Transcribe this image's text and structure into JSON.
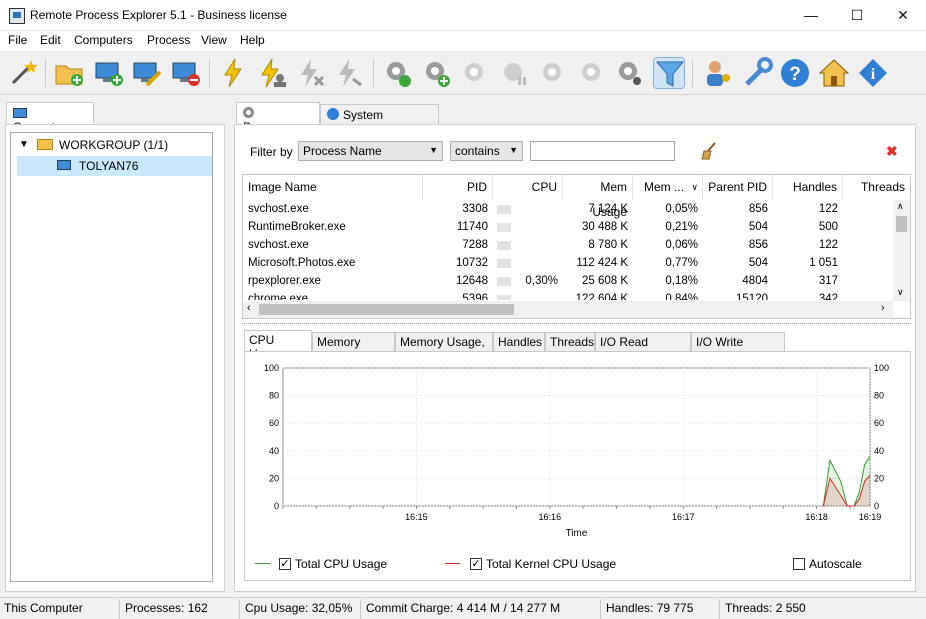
{
  "window": {
    "title": "Remote Process Explorer 5.1 - Business license",
    "minimize": "—",
    "maximize": "☐",
    "close": "✕"
  },
  "menu": [
    "File",
    "Edit",
    "Computers",
    "Process",
    "View",
    "Help"
  ],
  "left_panel": {
    "tab_label": "Computers",
    "group_label": "WORKGROUP (1/1)",
    "computer_label": "TOLYAN76"
  },
  "right_panel": {
    "tabs": [
      "Processes",
      "System Information"
    ],
    "filter": {
      "label": "Filter by",
      "field_value": "Process Name",
      "operator_value": "contains",
      "text_value": ""
    },
    "grid": {
      "columns": [
        "Image Name",
        "PID",
        "CPU",
        "Mem Usage",
        "Mem ...",
        "Parent PID",
        "Handles",
        "Threads"
      ],
      "rows": [
        {
          "name": "svchost.exe",
          "pid": "3308",
          "cpu": "",
          "mem": "7 124 K",
          "memp": "0,05%",
          "ppid": "856",
          "handles": "122"
        },
        {
          "name": "RuntimeBroker.exe",
          "pid": "11740",
          "cpu": "",
          "mem": "30 488 K",
          "memp": "0,21%",
          "ppid": "504",
          "handles": "500"
        },
        {
          "name": "svchost.exe",
          "pid": "7288",
          "cpu": "",
          "mem": "8 780 K",
          "memp": "0,06%",
          "ppid": "856",
          "handles": "122"
        },
        {
          "name": "Microsoft.Photos.exe",
          "pid": "10732",
          "cpu": "",
          "mem": "112 424 K",
          "memp": "0,77%",
          "ppid": "504",
          "handles": "1 051"
        },
        {
          "name": "rpexplorer.exe",
          "pid": "12648",
          "cpu": "0,30%",
          "mem": "25 608 K",
          "memp": "0,18%",
          "ppid": "4804",
          "handles": "317"
        },
        {
          "name": "chrome.exe",
          "pid": "5396",
          "cpu": "",
          "mem": "122 604 K",
          "memp": "0,84%",
          "ppid": "15120",
          "handles": "342"
        }
      ]
    },
    "chart_tabs": [
      "CPU Usage",
      "Memory Usage",
      "Memory Usage, %",
      "Handles",
      "Threads",
      "I/O Read Bytes/s",
      "I/O Write Bytes/s"
    ]
  },
  "chart_data": {
    "type": "area",
    "xlabel": "Time",
    "x_ticks": [
      "16:15",
      "16:16",
      "16:17",
      "16:18",
      "16:19"
    ],
    "y_ticks": [
      "100",
      "80",
      "60",
      "40",
      "20",
      "0"
    ],
    "y_ticks_right": [
      "100",
      "80",
      "60",
      "40",
      "20",
      "0"
    ],
    "ylim": [
      0,
      100
    ],
    "grid": true,
    "series": [
      {
        "name": "Total CPU Usage",
        "color": "#2ca02c",
        "x_min": [
          4.05,
          4.1,
          4.18,
          4.23,
          4.28,
          4.32,
          4.36,
          4.4
        ],
        "values": [
          0,
          33,
          18,
          0,
          0,
          10,
          30,
          36
        ]
      },
      {
        "name": "Total Kernel CPU Usage",
        "color": "#d62728",
        "x_min": [
          4.05,
          4.1,
          4.18,
          4.23,
          4.28,
          4.32,
          4.36,
          4.4
        ],
        "values": [
          0,
          20,
          8,
          0,
          0,
          5,
          18,
          22
        ]
      }
    ],
    "x_range_min": [
      0,
      4.4
    ],
    "x_tick_positions_min": [
      1,
      2,
      3,
      4,
      4.4
    ]
  },
  "legend": {
    "total_label": "Total CPU Usage",
    "kernel_label": "Total Kernel CPU Usage",
    "autoscale_label": "Autoscale",
    "total_checked": "✓",
    "kernel_checked": "✓"
  },
  "status": {
    "computer": "This Computer",
    "processes": "Processes: 162",
    "cpu": "Cpu Usage: 32,05%",
    "commit": "Commit Charge: 4 414 M / 14 277 M",
    "handles": "Handles: 79 775",
    "threads": "Threads: 2 550"
  }
}
